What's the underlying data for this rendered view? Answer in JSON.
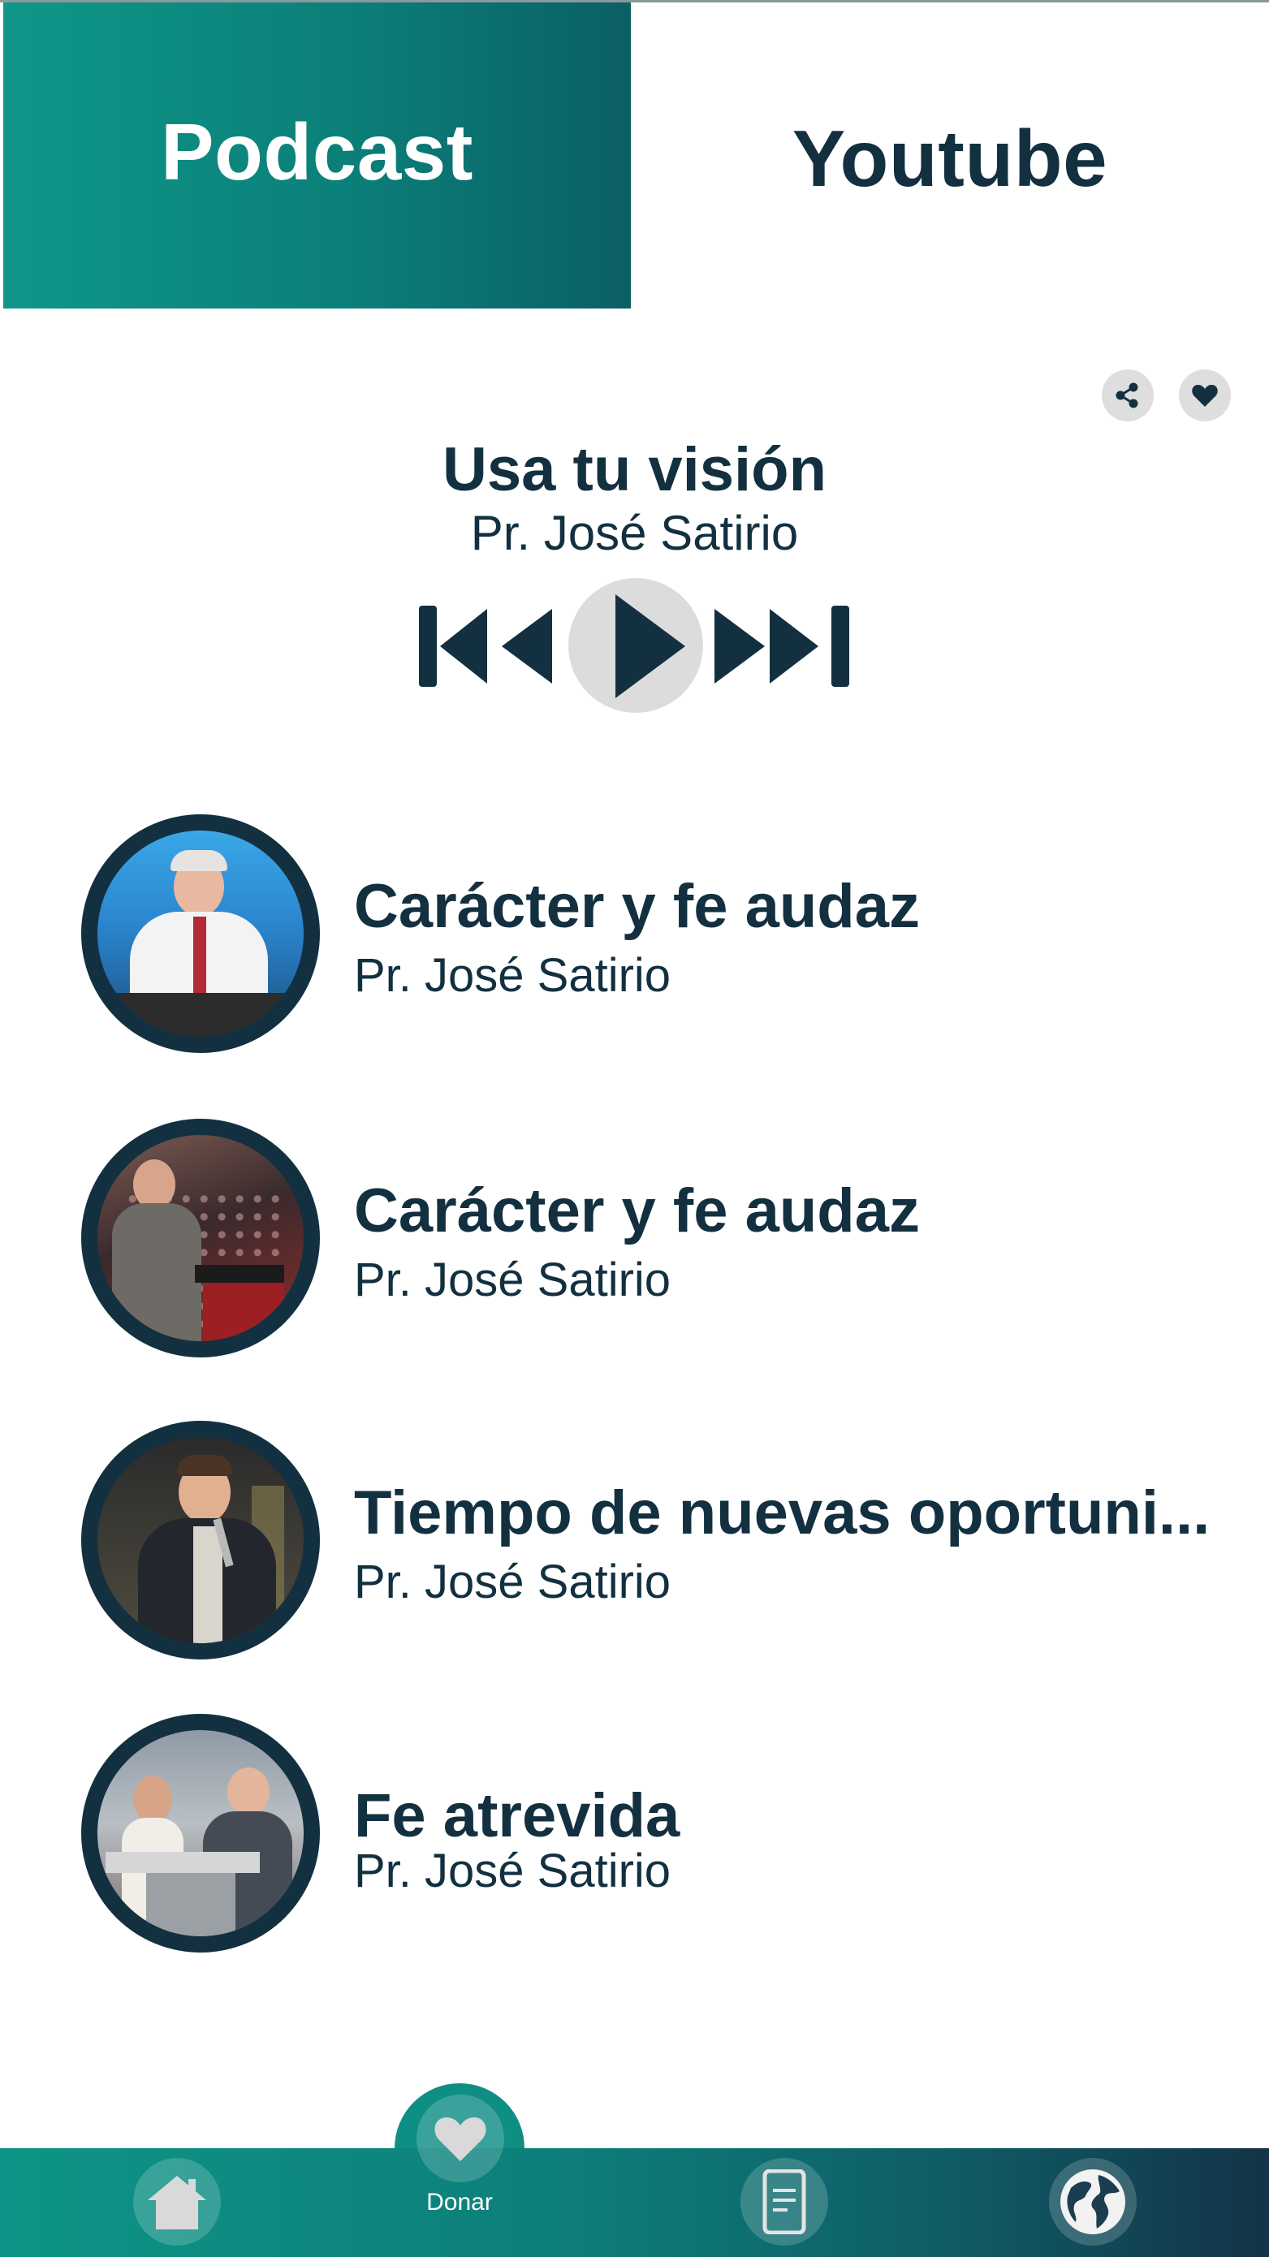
{
  "tabs": [
    {
      "label": "Podcast",
      "active": true
    },
    {
      "label": "Youtube",
      "active": false
    }
  ],
  "now_playing": {
    "title": "Usa tu visión",
    "author": "Pr. José Satirio"
  },
  "actions": {
    "share_icon": "share-icon",
    "favorite_icon": "heart-icon"
  },
  "player_controls": [
    "skip-previous-icon",
    "rewind-icon",
    "play-icon",
    "fast-forward-icon",
    "skip-next-icon"
  ],
  "episodes": [
    {
      "title": "Carácter y fe audaz",
      "author": "Pr. José Satirio"
    },
    {
      "title": "Carácter y fe audaz",
      "author": "Pr. José Satirio"
    },
    {
      "title": "Tiempo de nuevas oportuni...",
      "author": "Pr. José Satirio"
    },
    {
      "title": "Fe atrevida",
      "author": "Pr. José Satirio"
    }
  ],
  "bottom_nav": {
    "home_icon": "home-icon",
    "donate": {
      "label": "Donar",
      "icon": "heart-icon"
    },
    "document_icon": "document-icon",
    "globe_icon": "globe-icon"
  },
  "colors": {
    "primary_dark": "#133040",
    "teal": "#0f9789",
    "teal_dark": "#0b5f65",
    "control_bg": "#dedede"
  }
}
